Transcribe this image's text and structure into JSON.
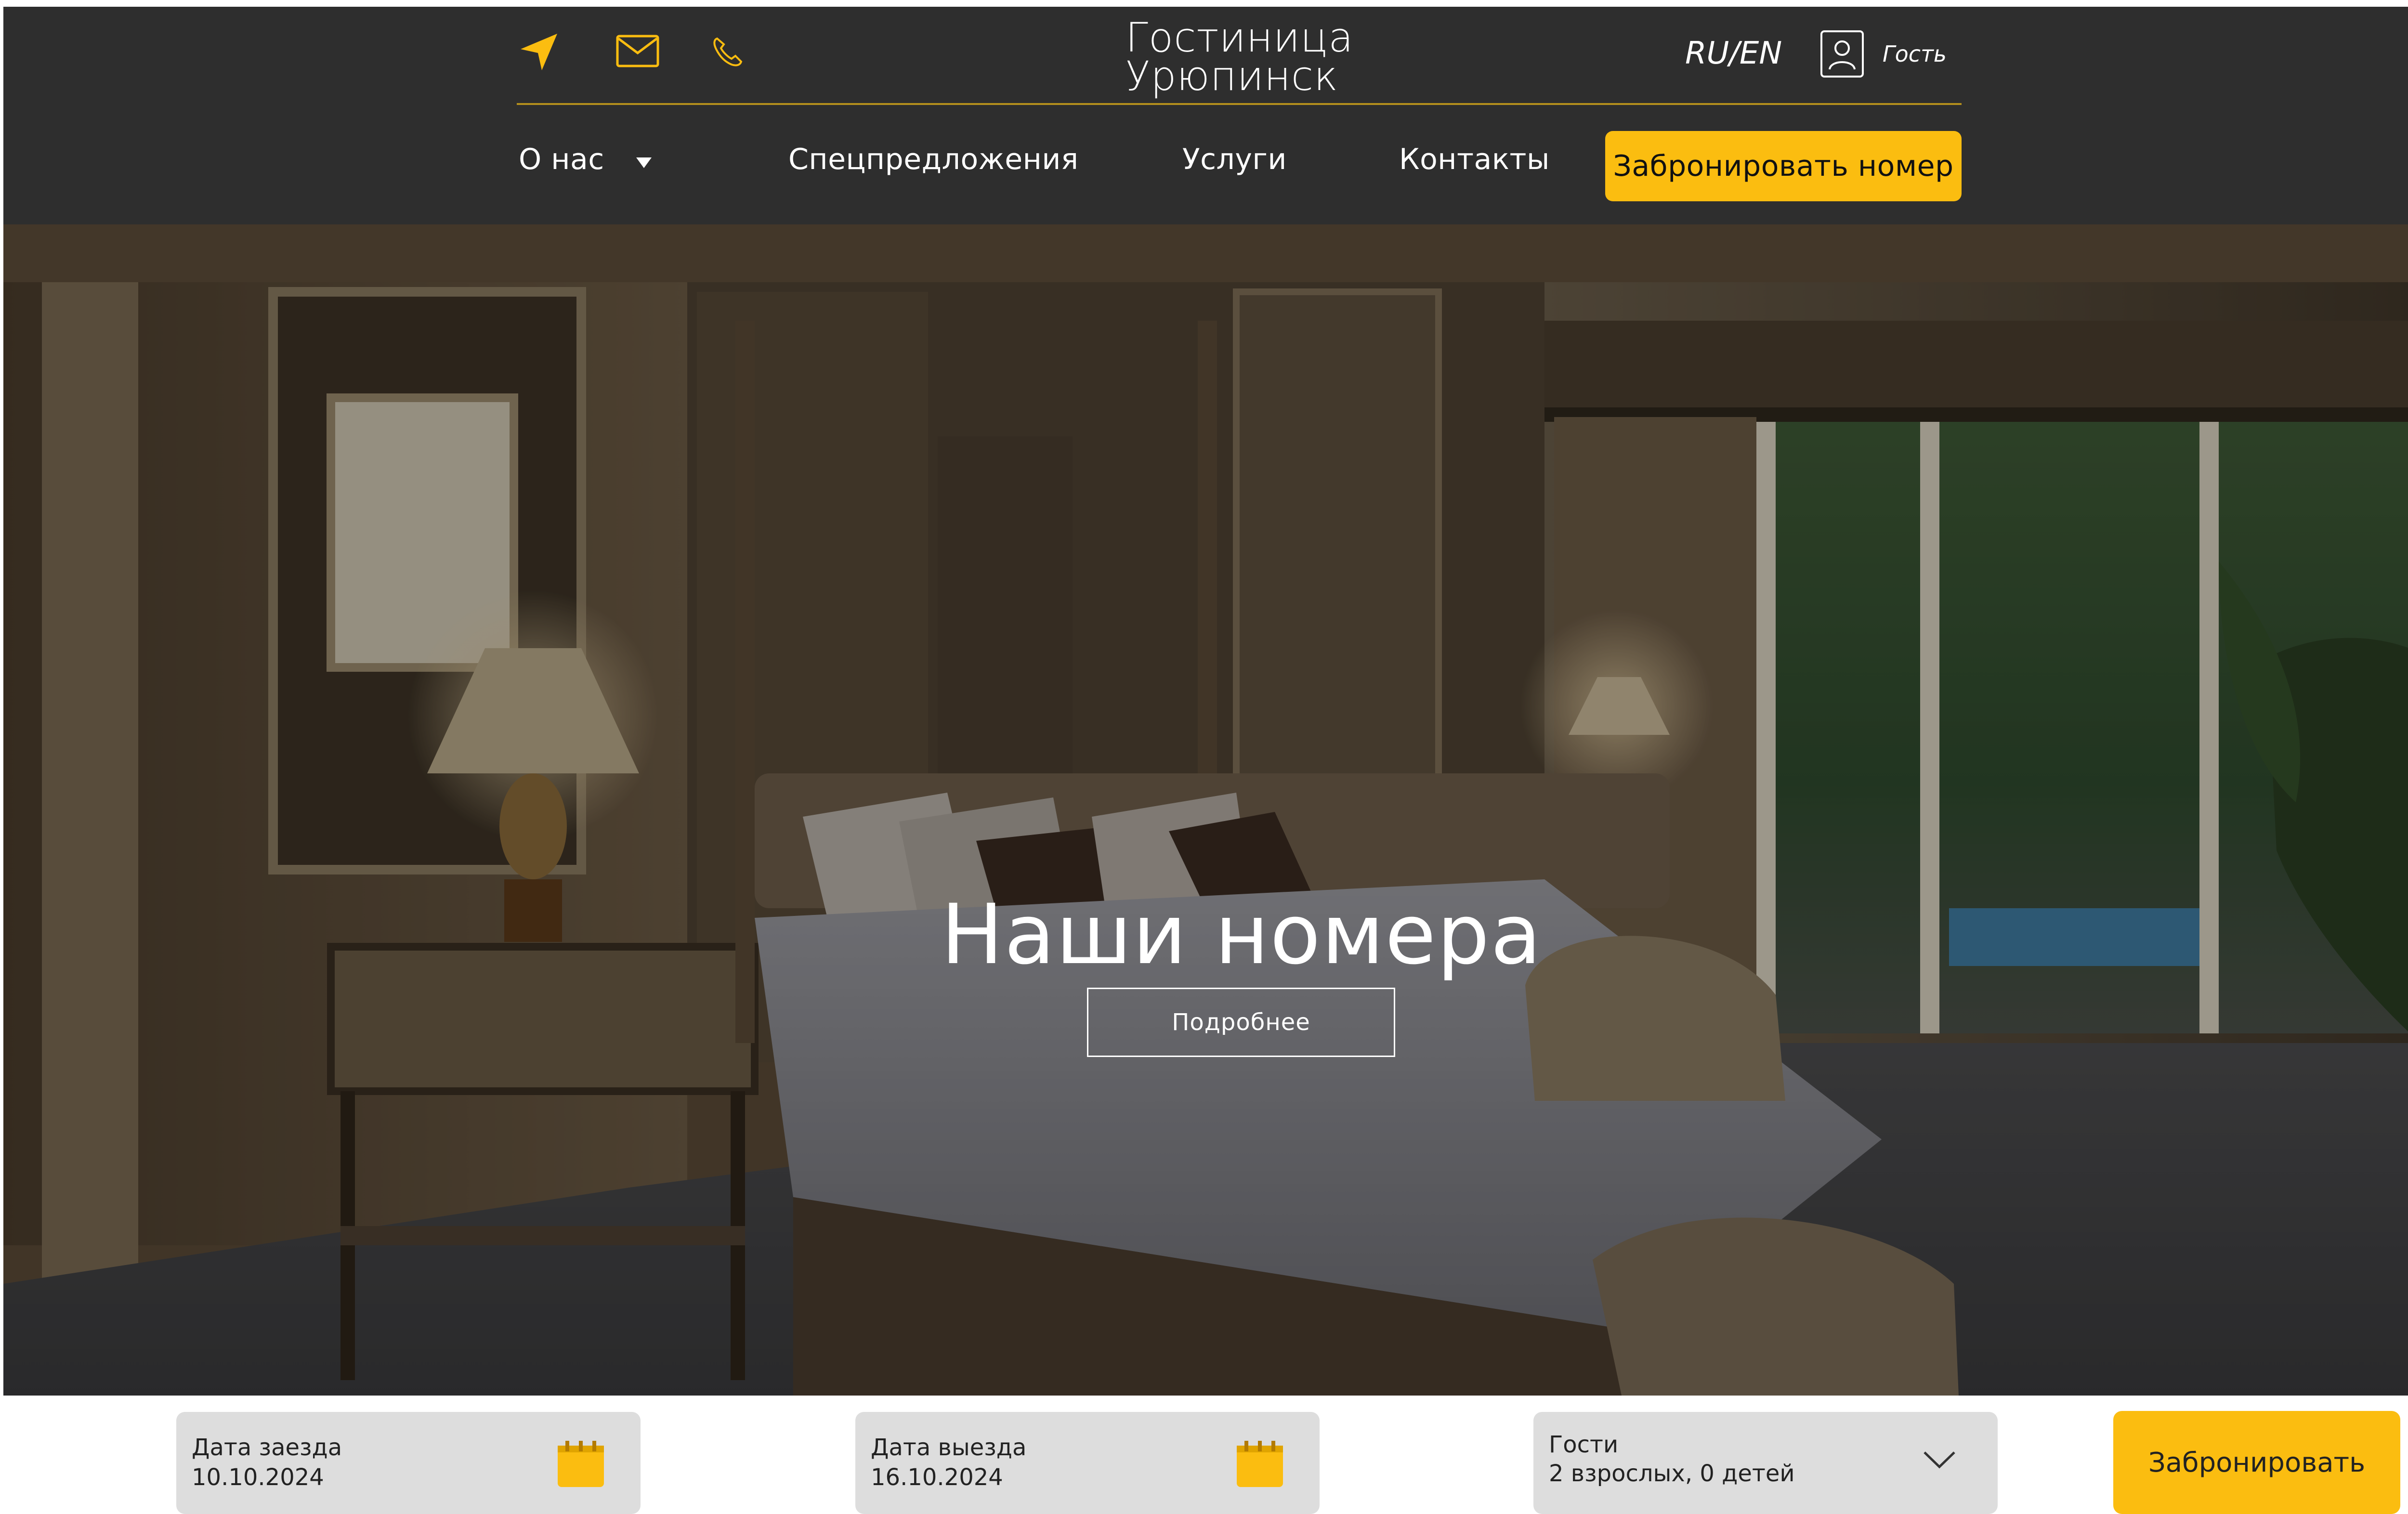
{
  "header": {
    "logo": [
      "Гостиница",
      "Урюпинск"
    ],
    "icons": [
      "location-arrow-icon",
      "mail-icon",
      "phone-icon"
    ],
    "lang": "RU/EN",
    "user_label": "Гость",
    "nav": {
      "about": "О нас",
      "specials": "Спецпредложения",
      "services": "Услуги",
      "contacts": "Контакты"
    },
    "book_room": "Забронировать номер"
  },
  "hero": {
    "title": "Наши номера",
    "more_button": "Подробнее"
  },
  "booking": {
    "checkin": {
      "label": "Дата заезда",
      "value": "10.10.2024"
    },
    "checkout": {
      "label": "Дата выезда",
      "value": "16.10.2024"
    },
    "guests": {
      "label": "Гости",
      "value": "2 взрослых, 0 детей"
    },
    "submit": "Забронировать"
  },
  "colors": {
    "accent": "#fbbd10",
    "header_bg": "#2e2e2e",
    "field_bg": "#dddddd",
    "divider": "#b38e1d"
  }
}
